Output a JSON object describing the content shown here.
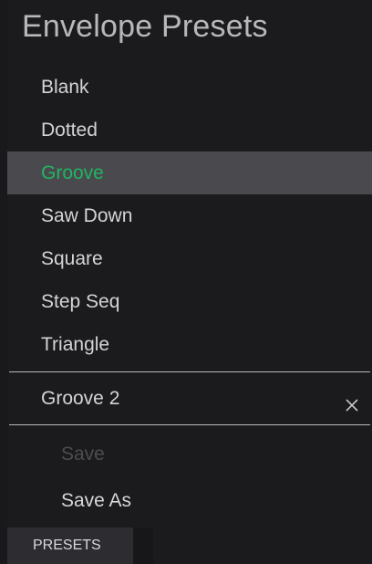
{
  "panel": {
    "title": "Envelope Presets",
    "selected_color": "#1fb561",
    "presets": [
      {
        "label": "Blank",
        "selected": false
      },
      {
        "label": "Dotted",
        "selected": false
      },
      {
        "label": "Groove",
        "selected": true
      },
      {
        "label": "Saw Down",
        "selected": false
      },
      {
        "label": "Square",
        "selected": false
      },
      {
        "label": "Step Seq",
        "selected": false
      },
      {
        "label": "Triangle",
        "selected": false
      }
    ],
    "user_preset": {
      "label": "Groove 2",
      "close_icon": "close-icon"
    },
    "actions": {
      "save_label": "Save",
      "save_as_label": "Save As"
    }
  },
  "tabs": {
    "presets_label": "PRESETS"
  }
}
